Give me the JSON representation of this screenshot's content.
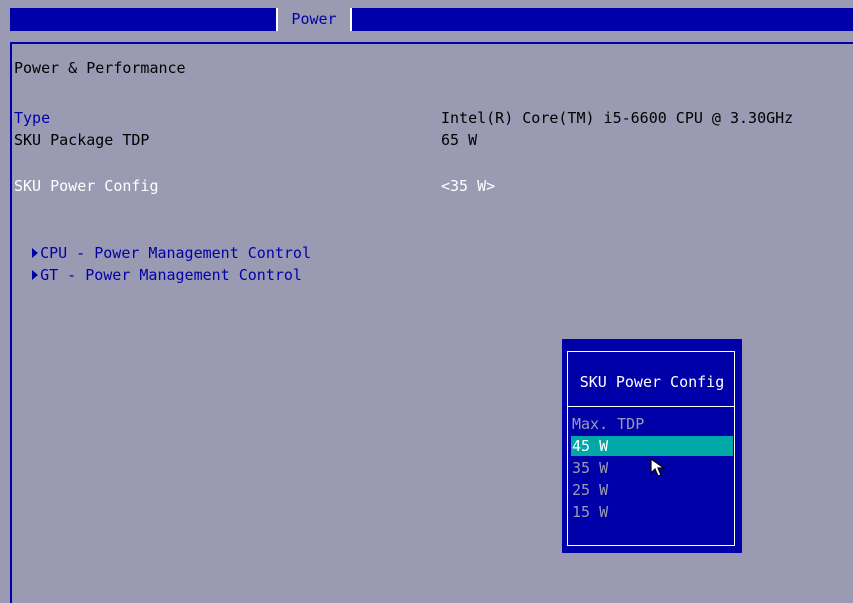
{
  "header": {
    "tab_label": "Power"
  },
  "main": {
    "section_title": "Power & Performance",
    "type_label": "Type",
    "type_value": "Intel(R) Core(TM) i5-6600 CPU @ 3.30GHz",
    "tdp_label": "SKU Package TDP",
    "tdp_value": "65 W",
    "config_label": "SKU Power Config",
    "config_value": "<35 W>",
    "submenus": [
      "CPU - Power Management Control",
      "GT - Power Management Control"
    ]
  },
  "popup": {
    "title": "SKU Power Config",
    "options": [
      "Max. TDP",
      "45 W",
      "35 W",
      "25 W",
      "15 W"
    ],
    "selected": "45 W"
  },
  "colors": {
    "background": "#9a9bb3",
    "accent": "#0000a8",
    "highlight": "#00a8a8",
    "text": "#ffffff"
  },
  "icons": {
    "pointer": "mouse-pointer-icon",
    "submenu": "triangle-right-icon"
  }
}
